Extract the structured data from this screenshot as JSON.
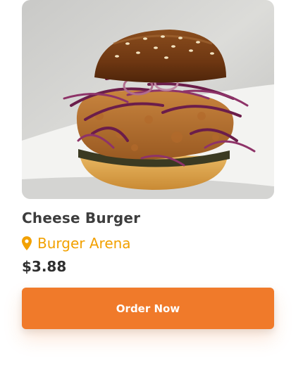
{
  "product": {
    "name": "Cheese Burger",
    "restaurant": "Burger Arena",
    "price": "$3.88",
    "image_icon": "burger-photo"
  },
  "actions": {
    "order_label": "Order Now"
  },
  "colors": {
    "accent": "#f07a2a",
    "location": "#f2a100",
    "title": "#3d3d3d"
  },
  "icons": {
    "location": "map-pin-icon"
  }
}
